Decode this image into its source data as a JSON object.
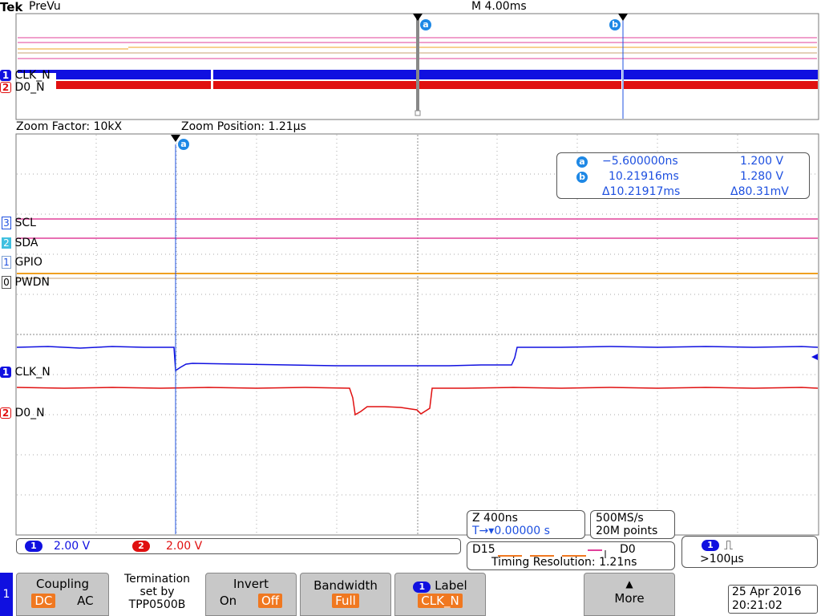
{
  "header": {
    "brand": "Tek",
    "mode": "PreVu",
    "horizontal_scale": "M 4.00ms"
  },
  "zoom": {
    "factor": "Zoom Factor: 10kX",
    "position": "Zoom Position: 1.21µs"
  },
  "preview_channels": [
    {
      "num": "1",
      "name": "CLK_N"
    },
    {
      "num": "2",
      "name": "D0_N"
    }
  ],
  "digital_channels": [
    {
      "num": "3",
      "name": "SCL"
    },
    {
      "num": "2",
      "name": "SDA"
    },
    {
      "num": "1",
      "name": "GPIO"
    },
    {
      "num": "0",
      "name": "PWDN"
    }
  ],
  "analog_channels": [
    {
      "num": "1",
      "name": "CLK_N",
      "scale": "2.00 V",
      "color": "#1010e0"
    },
    {
      "num": "2",
      "name": "D0_N",
      "scale": "2.00 V",
      "color": "#e01010"
    }
  ],
  "cursors": {
    "a_label": "a",
    "b_label": "b",
    "a_time": "−5.600000ns",
    "a_volt": "1.200 V",
    "b_time": "10.21916ms",
    "b_volt": "1.280 V",
    "delta_time": "Δ10.21917ms",
    "delta_volt": "Δ80.31mV"
  },
  "zoom_info": {
    "scale": "Z 400ns",
    "position": "0.00000 s"
  },
  "acquisition": {
    "rate": "500MS/s",
    "points": "20M points"
  },
  "digital_info": {
    "ch_hi": "D15",
    "ch_lo": "D0",
    "timing": "Timing Resolution: 1.21ns"
  },
  "trigger": {
    "source": "1",
    "condition": ">100µs"
  },
  "softkeys": {
    "side_tab": "1",
    "coupling_title": "Coupling",
    "coupling_dc": "DC",
    "coupling_ac": "AC",
    "termination_line1": "Termination",
    "termination_line2": "set by",
    "termination_line3": "TPP0500B",
    "invert_title": "Invert",
    "invert_on": "On",
    "invert_off": "Off",
    "bandwidth_title": "Bandwidth",
    "bandwidth_value": "Full",
    "label_title": "Label",
    "label_value": "CLK_N",
    "more": "More"
  },
  "datetime": {
    "date": "25 Apr 2016",
    "time": "20:21:02"
  },
  "colors": {
    "ch1": "#1010e0",
    "ch2": "#e01010",
    "scl": "#e0409a",
    "sda": "#e0409a",
    "gpio": "#f0a020",
    "pwdn": "#c8a070",
    "cursor": "#1e50e0",
    "select": "#f07820"
  }
}
